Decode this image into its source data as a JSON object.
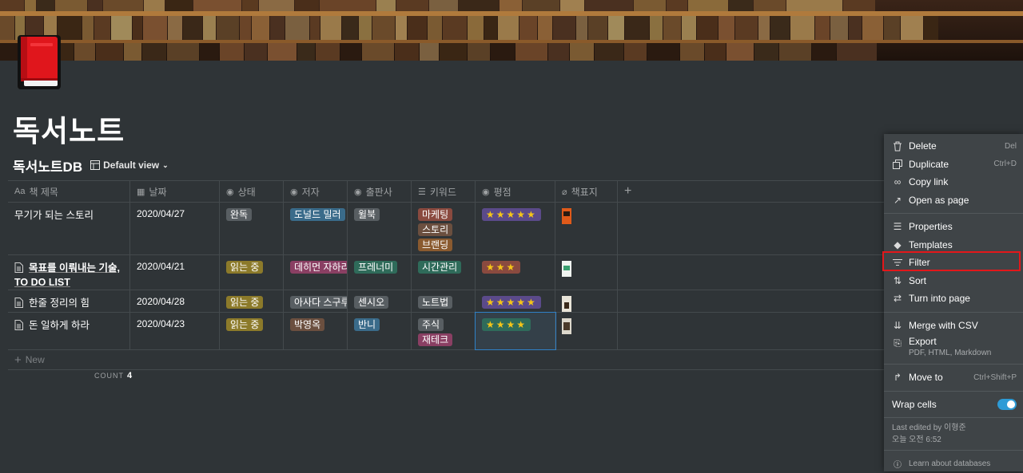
{
  "page": {
    "title": "독서노트",
    "db_title": "독서노트DB",
    "view_label": "Default view"
  },
  "columns": [
    "책 제목",
    "날짜",
    "상태",
    "저자",
    "출판사",
    "키워드",
    "평점",
    "책표지"
  ],
  "rows": [
    {
      "title": "무기가 되는 스토리",
      "date": "2020/04/27",
      "status": "완독",
      "author": "도널드 밀러",
      "publisher": "윌북",
      "keywords": [
        "마케팅",
        "스토리",
        "브랜딩"
      ],
      "rating": "★★★★★"
    },
    {
      "title_line1": "목표를 이뤄내는 기술,",
      "title_line2": "TO DO LIST",
      "date": "2020/04/21",
      "status": "읽는 중",
      "author": "데히먼 자하리",
      "publisher": "프레너미",
      "keywords": [
        "시간관리"
      ],
      "rating": "★★★"
    },
    {
      "title": "한줄 정리의 힘",
      "date": "2020/04/28",
      "status": "읽는 중",
      "author": "아사다 스구루",
      "publisher": "센시오",
      "keywords": [
        "노트법"
      ],
      "rating": "★★★★★"
    },
    {
      "title": "돈 일하게 하라",
      "date": "2020/04/23",
      "status": "읽는 중",
      "author": "박영옥",
      "publisher": "반니",
      "keywords": [
        "주식",
        "재테크"
      ],
      "rating": "★★★★"
    }
  ],
  "new_label": "New",
  "count_label": "COUNT",
  "count_value": "4",
  "menu": {
    "delete": "Delete",
    "delete_sc": "Del",
    "duplicate": "Duplicate",
    "duplicate_sc": "Ctrl+D",
    "copy_link": "Copy link",
    "open_as_page": "Open as page",
    "properties": "Properties",
    "templates": "Templates",
    "filter": "Filter",
    "sort": "Sort",
    "turn_into_page": "Turn into page",
    "merge_csv": "Merge with CSV",
    "export": "Export",
    "export_sub": "PDF, HTML, Markdown",
    "move_to": "Move to",
    "move_to_sc": "Ctrl+Shift+P",
    "wrap_cells": "Wrap cells",
    "last_edited_line1": "Last edited by 이형준",
    "last_edited_line2": "오늘 오전 6:52",
    "learn": "Learn about databases"
  }
}
